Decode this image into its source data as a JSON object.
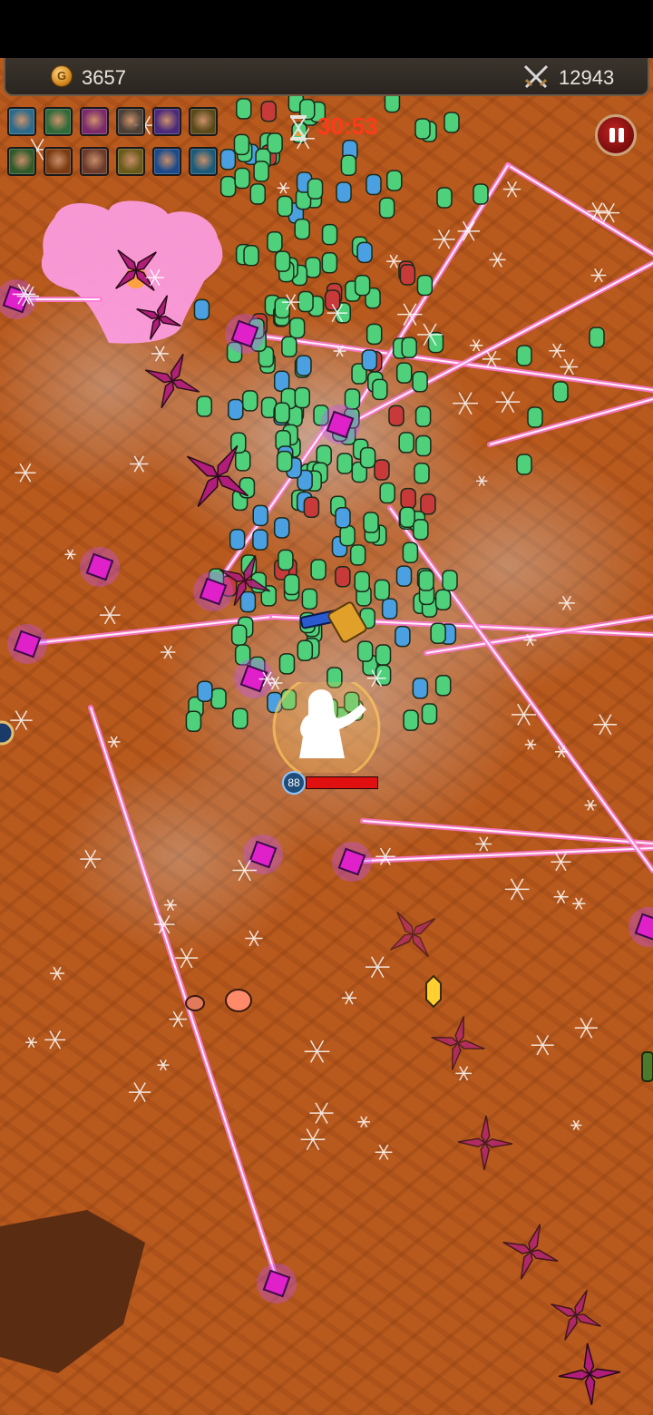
{
  "hud": {
    "gold_value": "3657",
    "kill_count": "12943",
    "coin_glyph": "G",
    "icons": {
      "gold": "gold-coin-icon",
      "kills": "crossed-swords-icon",
      "timer": "hourglass-icon",
      "pause": "pause-icon"
    }
  },
  "timer": {
    "value": "30:53",
    "color": "#ff3a1a"
  },
  "player": {
    "level": "88",
    "hp_fraction": 1.0
  },
  "skills": [
    {
      "name": "ice-shard-skill-icon",
      "color": "#2a6a8a"
    },
    {
      "name": "green-tome-skill-icon",
      "color": "#2f6a3a"
    },
    {
      "name": "shuriken-skill-icon",
      "color": "#7a2a6a"
    },
    {
      "name": "battle-axe-skill-icon",
      "color": "#4a4036"
    },
    {
      "name": "void-orb-skill-icon",
      "color": "#4a2a7a"
    },
    {
      "name": "fire-gourd-skill-icon",
      "color": "#5a4a1a"
    },
    {
      "name": "four-leaf-clover-skill-icon",
      "color": "#2f5a2a"
    },
    {
      "name": "war-horn-skill-icon",
      "color": "#7a3a12"
    },
    {
      "name": "spellbook-skill-icon",
      "color": "#6a3a2a"
    },
    {
      "name": "golden-crown-skill-icon",
      "color": "#6a5a1a"
    },
    {
      "name": "frost-ring-skill-icon",
      "color": "#1a4a8a"
    },
    {
      "name": "water-boots-skill-icon",
      "color": "#1a5a7a"
    }
  ],
  "colors": {
    "ground": "#b8591d",
    "laser": "#ff7ad8",
    "gem_green": "#4fd07a",
    "gem_blue": "#4aa0e0",
    "gem_red": "#c83a3a",
    "shuriken": "#b01e7a"
  }
}
